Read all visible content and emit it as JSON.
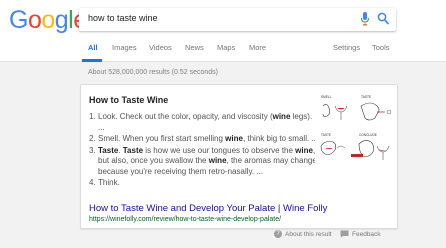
{
  "logo": {
    "letters": [
      "G",
      "o",
      "o",
      "g",
      "l",
      "e"
    ],
    "colors": [
      "#4285f4",
      "#ea4335",
      "#fbbc05",
      "#4285f4",
      "#34a853",
      "#ea4335"
    ]
  },
  "search": {
    "query": "how to taste wine"
  },
  "tabs": {
    "all": "All",
    "images": "Images",
    "videos": "Videos",
    "news": "News",
    "maps": "Maps",
    "more": "More",
    "settings": "Settings",
    "tools": "Tools"
  },
  "result_stats": "About 528,000,000 results (0.52 seconds)",
  "snippet": {
    "title": "How to Taste Wine",
    "steps": [
      {
        "num": "1.",
        "parts": [
          "Look. Check out the color, opacity, and viscosity (",
          "wine",
          " legs). ..."
        ]
      },
      {
        "num": "2.",
        "parts": [
          "Smell. When you first start smelling ",
          "wine",
          ", think big to small. ..."
        ]
      },
      {
        "num": "3.",
        "parts": [
          "",
          "Taste",
          ". ",
          "Taste",
          " is how we use our tongues to observe the ",
          "wine",
          ", but also, once you swallow the ",
          "wine",
          ", the aromas may change because you're receiving them retro-nasally. ..."
        ]
      },
      {
        "num": "4.",
        "parts": [
          "Think."
        ]
      }
    ],
    "thumb_labels": {
      "smell": "SMELL",
      "taste": "TASTE",
      "taste2": "TASTE",
      "conclude": "CONCLUDE"
    },
    "link": "How to Taste Wine and Develop Your Palate | Wine Folly",
    "url": "https://winefolly.com/review/how-to-taste-wine-develop-palate/"
  },
  "footer": {
    "about": "About this result",
    "feedback": "Feedback"
  },
  "colors": {
    "link": "#1a0dab",
    "url": "#006621",
    "accent": "#1a73e8",
    "wine": "#c0272d"
  }
}
